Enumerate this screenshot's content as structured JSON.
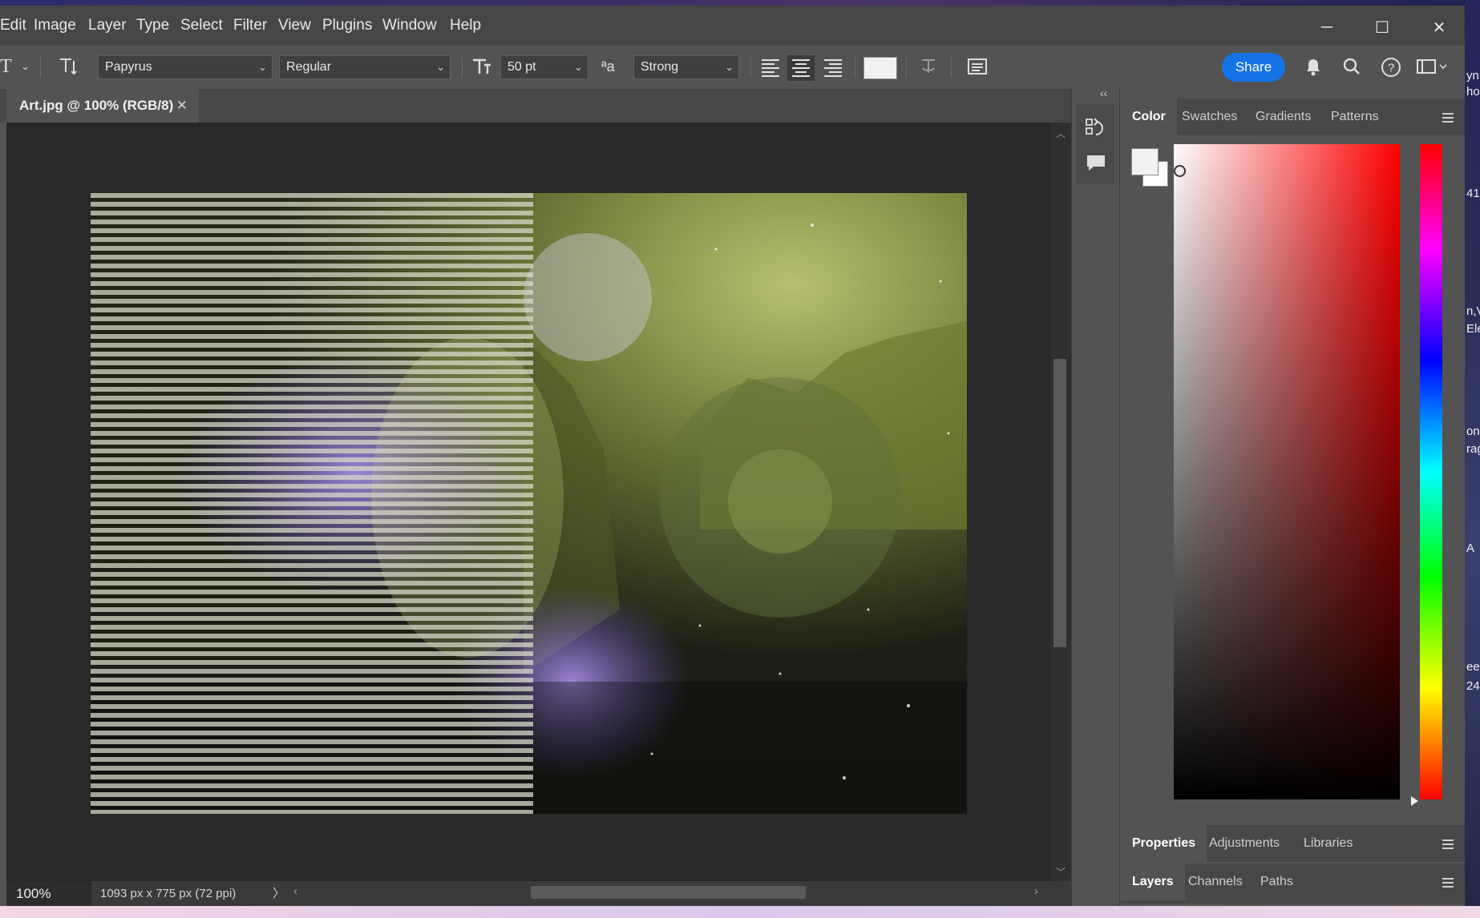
{
  "menubar": {
    "items": [
      "Edit",
      "Image",
      "Layer",
      "Type",
      "Select",
      "Filter",
      "View",
      "Plugins",
      "Window",
      "Help"
    ],
    "window_controls": {
      "minimize": "─",
      "maximize": "☐",
      "close": "✕"
    }
  },
  "options": {
    "tool_glyph": "T",
    "font_family": "Papyrus",
    "font_style": "Regular",
    "font_size": "50 pt",
    "antialias": "Strong",
    "share_label": "Share"
  },
  "document": {
    "tab_title": "Art.jpg @ 100% (RGB/8)",
    "zoom": "100%",
    "info": "1093 px x 775 px (72 ppi)"
  },
  "color_panel": {
    "tabs": [
      "Color",
      "Swatches",
      "Gradients",
      "Patterns"
    ],
    "active": "Color",
    "foreground": "#f2f2f2",
    "background": "#ffffff"
  },
  "properties_panel": {
    "tabs": [
      "Properties",
      "Adjustments",
      "Libraries"
    ]
  },
  "layers_panel": {
    "tabs": [
      "Layers",
      "Channels",
      "Paths"
    ]
  },
  "desktop_fragments": [
    "yn",
    "ho",
    "41",
    "n,V",
    "Ele",
    "on",
    "rag",
    "A",
    "ee",
    "24"
  ]
}
